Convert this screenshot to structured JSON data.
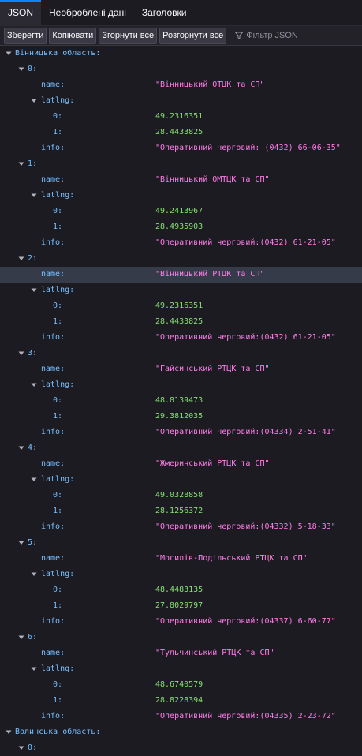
{
  "tabs": [
    {
      "label": "JSON",
      "active": true
    },
    {
      "label": "Необроблені дані",
      "active": false
    },
    {
      "label": "Заголовки",
      "active": false
    }
  ],
  "toolbar": {
    "save": "Зберегти",
    "copy": "Копіювати",
    "collapse": "Згорнути все",
    "expand": "Розгорнути все",
    "filter_placeholder": "Фільтр JSON"
  },
  "colors": {
    "key": "#75bfff",
    "string": "#ff7de9",
    "number": "#86de74",
    "selected_row": "#353b48"
  },
  "tree": {
    "region1": "Вінницька область:",
    "region2": "Волинська область:",
    "items": [
      {
        "index": "0:",
        "name": "\"Вінницький ОТЦК та СП\"",
        "lat": "49.2316351",
        "lng": "28.4433825",
        "info": "\"Оперативний черговий: (0432) 66-06-35\""
      },
      {
        "index": "1:",
        "name": "\"Вінницький ОМТЦК та СП\"",
        "lat": "49.2413967",
        "lng": "28.4935903",
        "info": "\"Оперативний черговий:(0432) 61-21-05\""
      },
      {
        "index": "2:",
        "name": "\"Вінницький РТЦК та СП\"",
        "lat": "49.2316351",
        "lng": "28.4433825",
        "info": "\"Оперативний черговий:(0432) 61-21-05\""
      },
      {
        "index": "3:",
        "name": "\"Гайсинський РТЦК та СП\"",
        "lat": "48.8139473",
        "lng": "29.3812035",
        "info": "\"Оперативний черговий:(04334) 2-51-41\""
      },
      {
        "index": "4:",
        "name": "\"Жмеринський РТЦК та СП\"",
        "lat": "49.0328858",
        "lng": "28.1256372",
        "info": "\"Оперативний черговий:(04332) 5-18-33\""
      },
      {
        "index": "5:",
        "name": "\"Могилів-Подільський РТЦК та СП\"",
        "lat": "48.4483135",
        "lng": "27.8029797",
        "info": "\"Оперативний черговий:(04337) 6-60-77\""
      },
      {
        "index": "6:",
        "name": "\"Тульчинський РТЦК та СП\"",
        "lat": "48.6740579",
        "lng": "28.8228394",
        "info": "\"Оперативний черговий:(04335) 2-23-72\""
      }
    ],
    "region2_first_index": "0:",
    "keys": {
      "name": "name:",
      "latlng": "latlng:",
      "idx0": "0:",
      "idx1": "1:",
      "info": "info:"
    },
    "selected_row": "2.name"
  }
}
